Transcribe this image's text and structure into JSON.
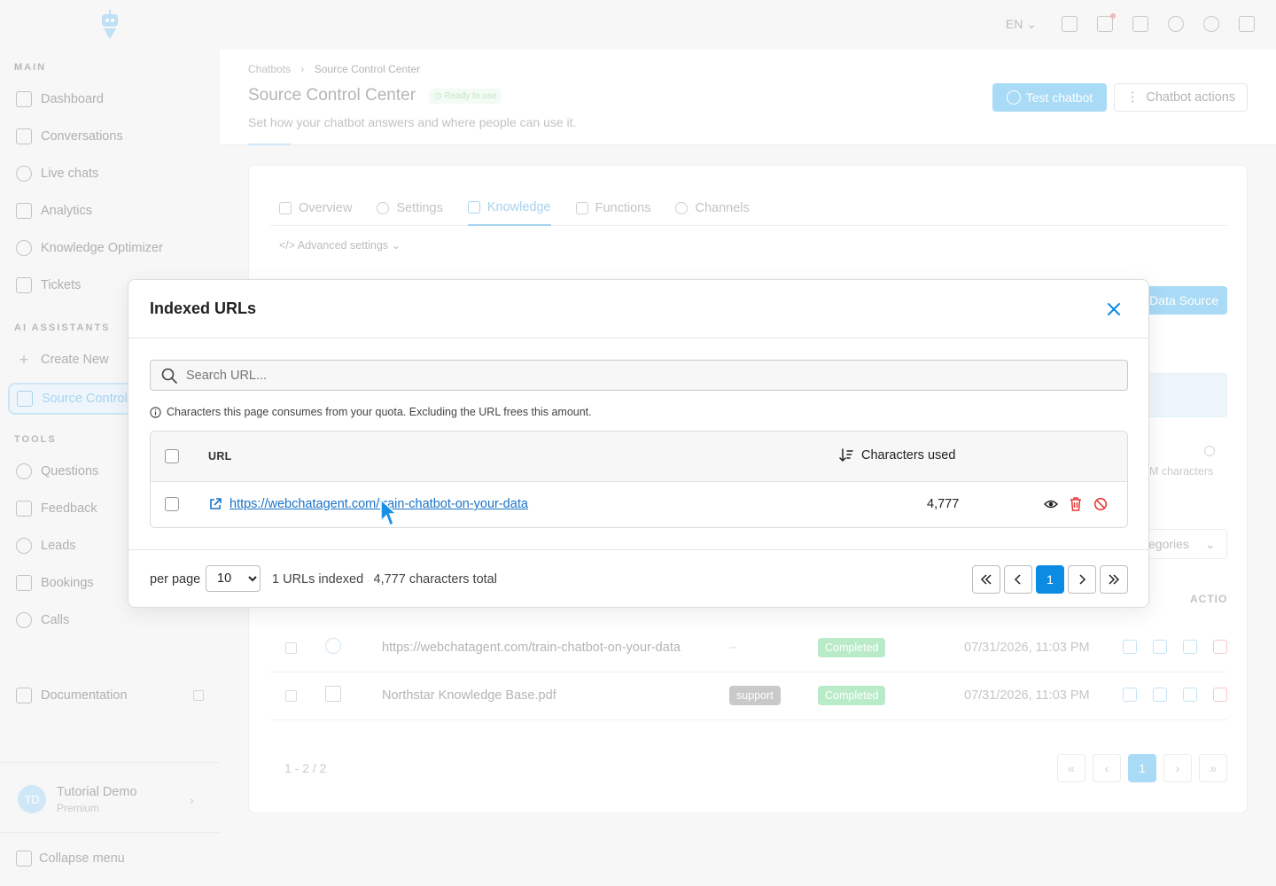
{
  "app": {
    "top_bar": {
      "language": "EN"
    },
    "sidebar": {
      "sections": {
        "main": "MAIN",
        "ai_assistants": "AI ASSISTANTS",
        "tools": "TOOLS"
      },
      "main_items": [
        "Dashboard",
        "Conversations",
        "Live chats",
        "Analytics",
        "Knowledge Optimizer",
        "Tickets"
      ],
      "create_new": "Create New",
      "active_bot": "Source Control",
      "tool_items": [
        "Questions",
        "Feedback",
        "Leads",
        "Bookings",
        "Calls"
      ],
      "documentation": "Documentation",
      "user": {
        "initials": "TD",
        "name": "Tutorial Demo",
        "plan": "Premium"
      },
      "collapse": "Collapse menu"
    },
    "header": {
      "breadcrumb": [
        "Chatbots",
        "Source Control Center"
      ],
      "title": "Source Control Center",
      "status": "Ready to use",
      "subtitle": "Set how your chatbot answers and where people can use it.",
      "test_button": "Test chatbot",
      "actions_button": "Chatbot actions"
    },
    "tabs": [
      "Overview",
      "Settings",
      "Knowledge",
      "Functions",
      "Channels"
    ],
    "active_tab": "Knowledge",
    "advanced_settings": "Advanced settings",
    "background": {
      "data_source_button": "Data Source",
      "chars_fragment": "M characters",
      "categories_fragment": "egories",
      "actions_header": "ACTIO",
      "rows": [
        {
          "source": "https://webchatagent.com/train-chatbot-on-your-data",
          "category": "–",
          "status": "Completed",
          "date": "07/31/2026, 11:03 PM"
        },
        {
          "source": "Northstar Knowledge Base.pdf",
          "category": "support",
          "status": "Completed",
          "date": "07/31/2026, 11:03 PM"
        }
      ],
      "pager_info": "1 - 2 / 2",
      "current_page": "1"
    }
  },
  "modal": {
    "title": "Indexed URLs",
    "search_placeholder": "Search URL...",
    "hint": "Characters this page consumes from your quota. Excluding the URL frees this amount.",
    "columns": {
      "url": "URL",
      "chars": "Characters used"
    },
    "rows": [
      {
        "url": "https://webchatagent.com/train-chatbot-on-your-data",
        "chars": "4,777"
      }
    ],
    "per_page_label": "per page",
    "per_page_value": "10",
    "urls_indexed": "1 URLs indexed",
    "chars_total": "4,777 characters total",
    "current_page": "1"
  },
  "colors": {
    "accent": "#0c8be2",
    "link": "#1a73c7",
    "danger": "#e53935"
  }
}
